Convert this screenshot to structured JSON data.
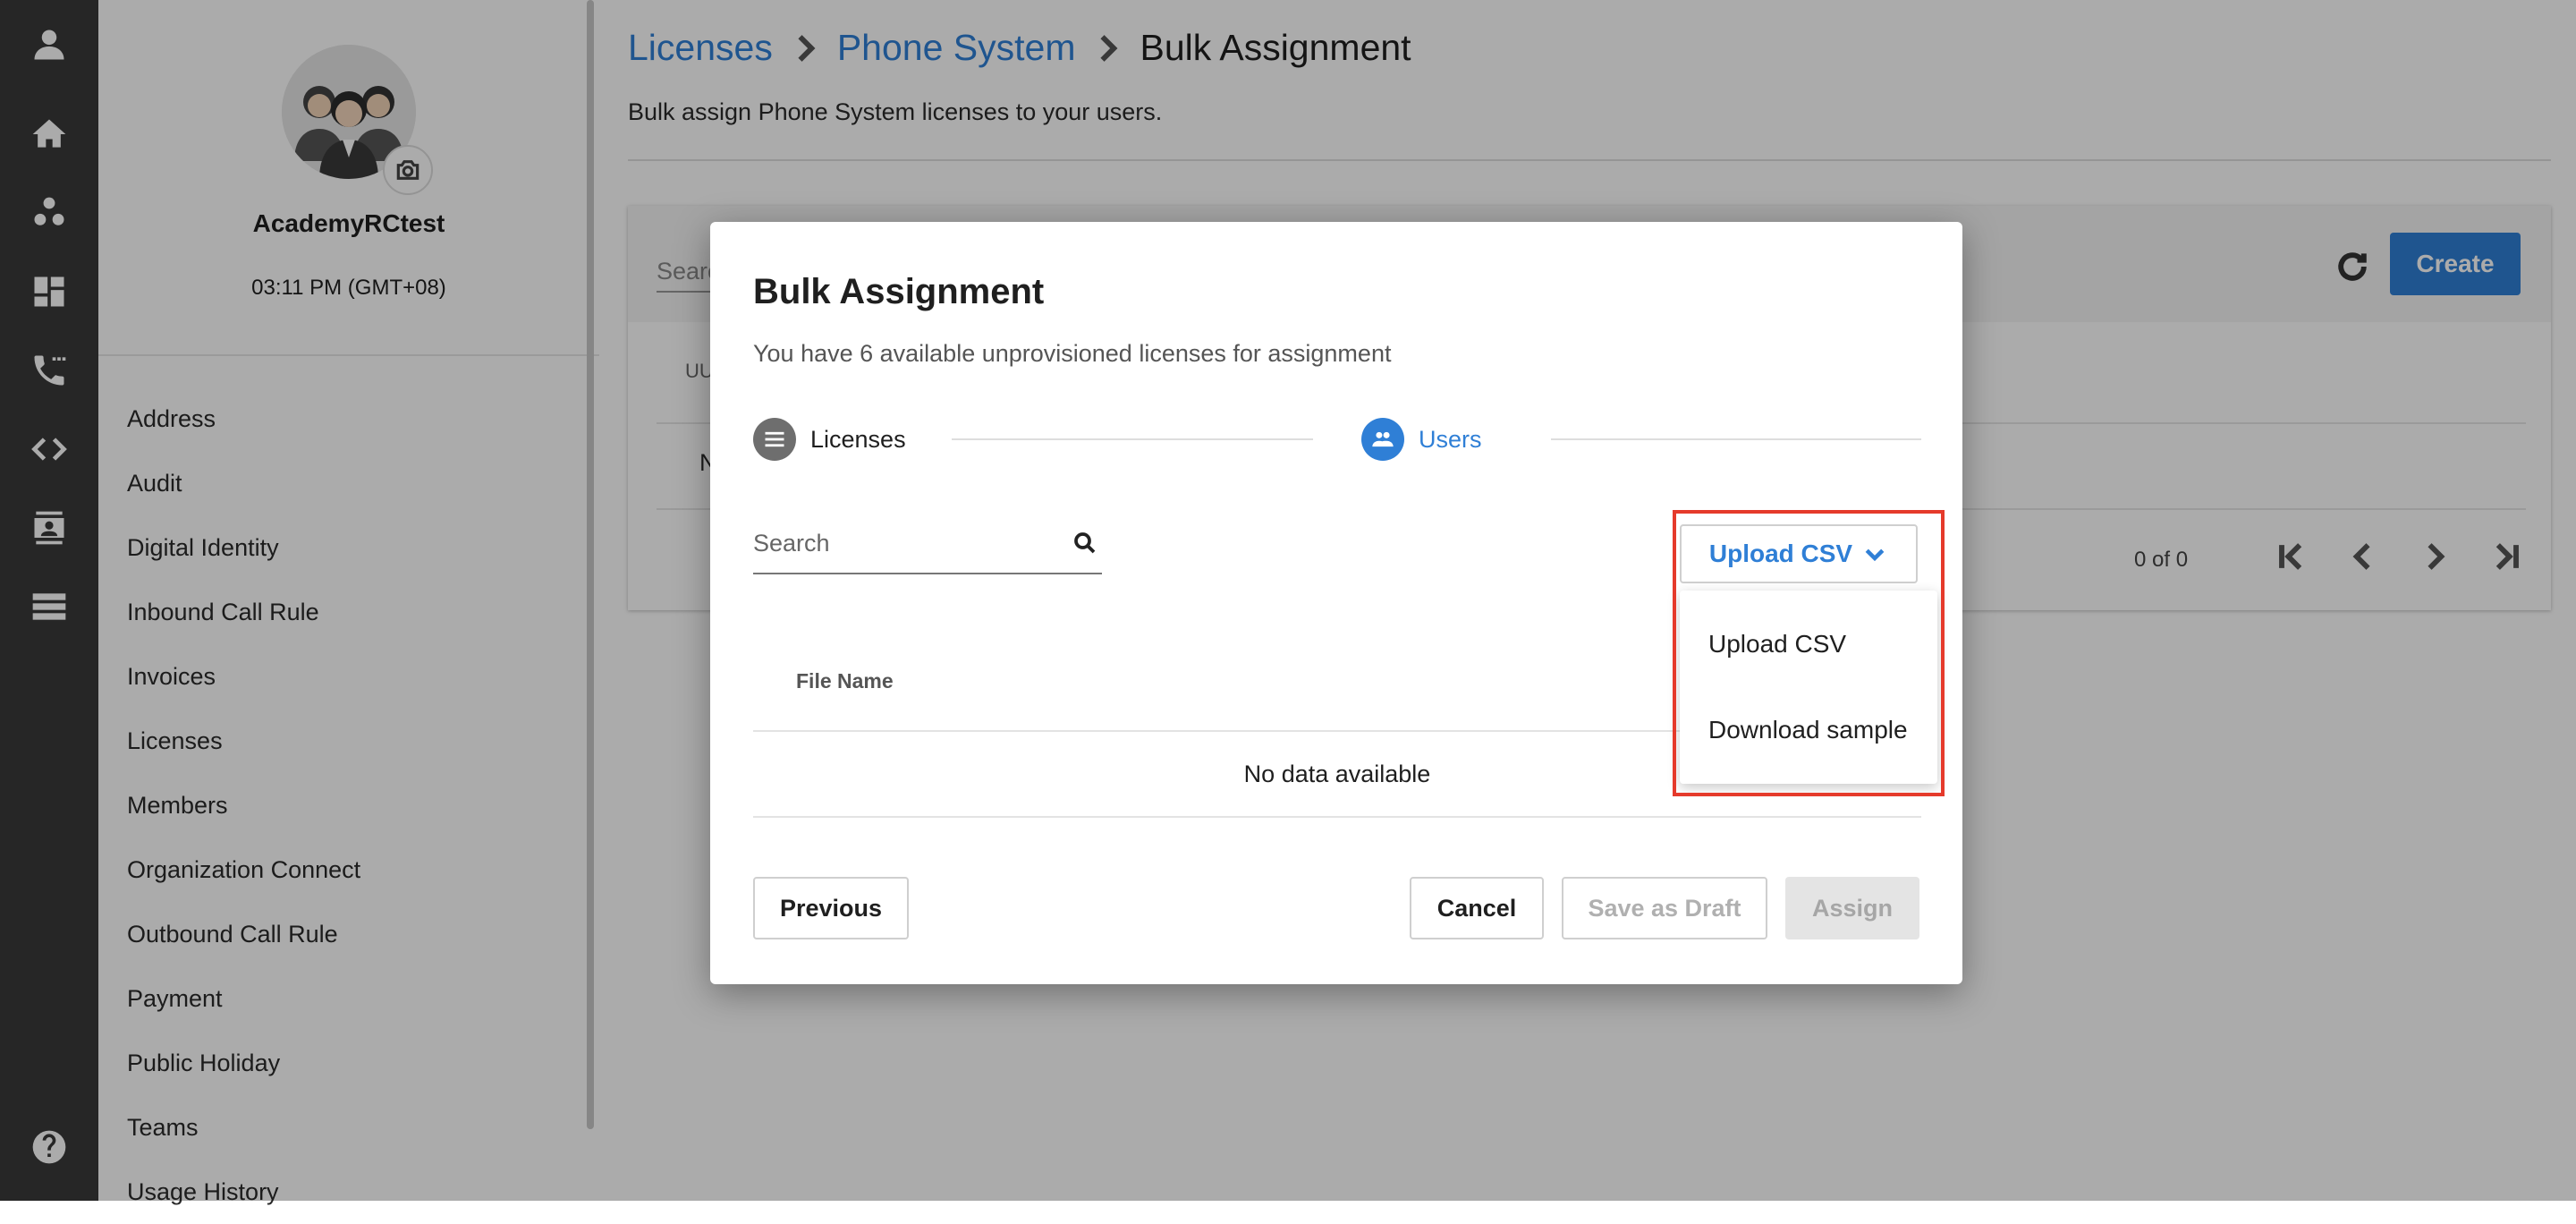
{
  "account": {
    "name": "AcademyRCtest",
    "time": "03:11 PM (GMT+08)"
  },
  "rail": {
    "icons": [
      "user-icon",
      "home-icon",
      "group-icon",
      "dashboard-icon",
      "phone-forward-icon",
      "code-icon",
      "contact-card-icon",
      "list-icon",
      "help-icon"
    ]
  },
  "menu": {
    "items": [
      "Address",
      "Audit",
      "Digital Identity",
      "Inbound Call Rule",
      "Invoices",
      "Licenses",
      "Members",
      "Organization Connect",
      "Outbound Call Rule",
      "Payment",
      "Public Holiday",
      "Teams",
      "Usage History"
    ]
  },
  "breadcrumb": {
    "level1": "Licenses",
    "level2": "Phone System",
    "current": "Bulk Assignment"
  },
  "page": {
    "subtitle": "Bulk assign Phone System licenses to your users."
  },
  "background": {
    "search_label": "Searc",
    "column": "UU",
    "row_text": "N",
    "create_label": "Create",
    "pager_count": "0 of 0"
  },
  "modal": {
    "title": "Bulk Assignment",
    "subtitle": "You have 6 available unprovisioned licenses for assignment",
    "steps": [
      {
        "label": "Licenses",
        "active": false
      },
      {
        "label": "Users",
        "active": true
      }
    ],
    "search_placeholder": "Search",
    "table": {
      "column": "File Name",
      "empty": "No data available"
    },
    "buttons": {
      "previous": "Previous",
      "cancel": "Cancel",
      "save_draft": "Save as Draft",
      "assign": "Assign"
    },
    "upload": {
      "label": "Upload CSV",
      "options": [
        "Upload CSV",
        "Download sample"
      ]
    }
  },
  "colors": {
    "accent": "#2f7fd6",
    "rail": "#3a3a3a",
    "highlight": "#e53a2b",
    "step_inactive": "#6e6e6e"
  }
}
